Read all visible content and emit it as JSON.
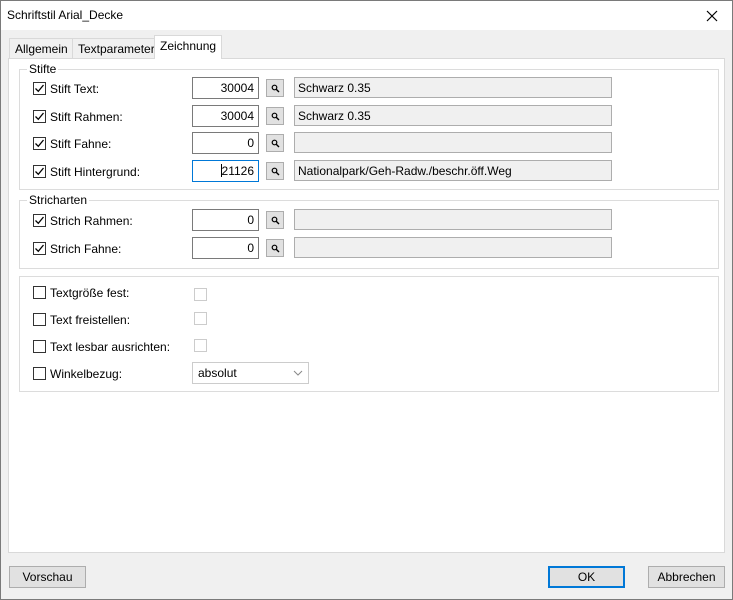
{
  "window": {
    "title": "Schriftstil Arial_Decke",
    "close_icon": "close-icon"
  },
  "tabs": [
    {
      "label": "Allgemein",
      "active": false
    },
    {
      "label": "Textparameter",
      "active": false
    },
    {
      "label": "Zeichnung",
      "active": true
    }
  ],
  "stifte": {
    "title": "Stifte",
    "rows": [
      {
        "label": "Stift Text:",
        "checked": true,
        "value": "30004",
        "description": "Schwarz 0.35"
      },
      {
        "label": "Stift Rahmen:",
        "checked": true,
        "value": "30004",
        "description": "Schwarz 0.35"
      },
      {
        "label": "Stift Fahne:",
        "checked": true,
        "value": "0",
        "description": ""
      },
      {
        "label": "Stift Hintergrund:",
        "checked": true,
        "value": "21126",
        "description": "Nationalpark/Geh-Radw./beschr.öff.Weg"
      }
    ]
  },
  "stricharten": {
    "title": "Stricharten",
    "rows": [
      {
        "label": "Strich Rahmen:",
        "checked": true,
        "value": "0",
        "description": ""
      },
      {
        "label": "Strich Fahne:",
        "checked": true,
        "value": "0",
        "description": ""
      }
    ]
  },
  "options": {
    "rows": [
      {
        "label": "Textgröße fest:",
        "checked": false
      },
      {
        "label": "Text freistellen:",
        "checked": false
      },
      {
        "label": "Text lesbar ausrichten:",
        "checked": false
      }
    ],
    "winkel_label": "Winkelbezug:",
    "winkel_checked": false,
    "winkel_value": "absolut"
  },
  "buttons": {
    "preview": "Vorschau",
    "ok": "OK",
    "cancel": "Abbrechen"
  },
  "colors": {
    "focus": "#0078d7",
    "panel": "#ffffff",
    "dialog": "#f0f0f0"
  }
}
